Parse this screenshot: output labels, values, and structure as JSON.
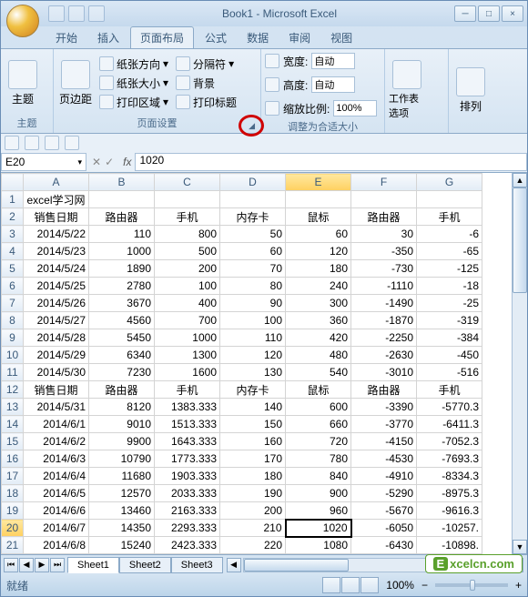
{
  "title": "Book1 - Microsoft Excel",
  "tabs": {
    "t0": "开始",
    "t1": "插入",
    "t2": "页面布局",
    "t3": "公式",
    "t4": "数据",
    "t5": "审阅",
    "t6": "视图"
  },
  "ribbon": {
    "theme_label": "主题",
    "theme_btn": "主题",
    "margins": "页边距",
    "page_setup_label": "页面设置",
    "orientation": "纸张方向",
    "size": "纸张大小",
    "print_area": "打印区域",
    "breaks": "分隔符",
    "background": "背景",
    "print_titles": "打印标题",
    "width_label": "宽度:",
    "height_label": "高度:",
    "scale_label": "缩放比例:",
    "auto": "自动",
    "scale_value": "100%",
    "scale_group": "调整为合适大小",
    "sheet_options": "工作表选项",
    "arrange": "排列"
  },
  "namebox": "E20",
  "formula": "1020",
  "columns": [
    "A",
    "B",
    "C",
    "D",
    "E",
    "F",
    "G"
  ],
  "rows": [
    {
      "n": "1",
      "cells": [
        "excel学习网",
        "",
        "",
        "",
        "",
        "",
        ""
      ],
      "text": true
    },
    {
      "n": "2",
      "cells": [
        "销售日期",
        "路由器",
        "手机",
        "内存卡",
        "鼠标",
        "路由器",
        "手机"
      ],
      "text": true
    },
    {
      "n": "3",
      "cells": [
        "2014/5/22",
        "110",
        "800",
        "50",
        "60",
        "30",
        "-6"
      ]
    },
    {
      "n": "4",
      "cells": [
        "2014/5/23",
        "1000",
        "500",
        "60",
        "120",
        "-350",
        "-65"
      ]
    },
    {
      "n": "5",
      "cells": [
        "2014/5/24",
        "1890",
        "200",
        "70",
        "180",
        "-730",
        "-125"
      ]
    },
    {
      "n": "6",
      "cells": [
        "2014/5/25",
        "2780",
        "100",
        "80",
        "240",
        "-1110",
        "-18"
      ]
    },
    {
      "n": "7",
      "cells": [
        "2014/5/26",
        "3670",
        "400",
        "90",
        "300",
        "-1490",
        "-25"
      ]
    },
    {
      "n": "8",
      "cells": [
        "2014/5/27",
        "4560",
        "700",
        "100",
        "360",
        "-1870",
        "-319"
      ]
    },
    {
      "n": "9",
      "cells": [
        "2014/5/28",
        "5450",
        "1000",
        "110",
        "420",
        "-2250",
        "-384"
      ]
    },
    {
      "n": "10",
      "cells": [
        "2014/5/29",
        "6340",
        "1300",
        "120",
        "480",
        "-2630",
        "-450"
      ]
    },
    {
      "n": "11",
      "cells": [
        "2014/5/30",
        "7230",
        "1600",
        "130",
        "540",
        "-3010",
        "-516"
      ]
    },
    {
      "n": "12",
      "cells": [
        "销售日期",
        "路由器",
        "手机",
        "内存卡",
        "鼠标",
        "路由器",
        "手机"
      ],
      "text": true
    },
    {
      "n": "13",
      "cells": [
        "2014/5/31",
        "8120",
        "1383.333",
        "140",
        "600",
        "-3390",
        "-5770.3"
      ]
    },
    {
      "n": "14",
      "cells": [
        "2014/6/1",
        "9010",
        "1513.333",
        "150",
        "660",
        "-3770",
        "-6411.3"
      ]
    },
    {
      "n": "15",
      "cells": [
        "2014/6/2",
        "9900",
        "1643.333",
        "160",
        "720",
        "-4150",
        "-7052.3"
      ]
    },
    {
      "n": "16",
      "cells": [
        "2014/6/3",
        "10790",
        "1773.333",
        "170",
        "780",
        "-4530",
        "-7693.3"
      ]
    },
    {
      "n": "17",
      "cells": [
        "2014/6/4",
        "11680",
        "1903.333",
        "180",
        "840",
        "-4910",
        "-8334.3"
      ]
    },
    {
      "n": "18",
      "cells": [
        "2014/6/5",
        "12570",
        "2033.333",
        "190",
        "900",
        "-5290",
        "-8975.3"
      ]
    },
    {
      "n": "19",
      "cells": [
        "2014/6/6",
        "13460",
        "2163.333",
        "200",
        "960",
        "-5670",
        "-9616.3"
      ]
    },
    {
      "n": "20",
      "cells": [
        "2014/6/7",
        "14350",
        "2293.333",
        "210",
        "1020",
        "-6050",
        "-10257."
      ]
    },
    {
      "n": "21",
      "cells": [
        "2014/6/8",
        "15240",
        "2423.333",
        "220",
        "1080",
        "-6430",
        "-10898."
      ]
    }
  ],
  "selected": {
    "row": "20",
    "col": 4
  },
  "sheets": {
    "s1": "Sheet1",
    "s2": "Sheet2",
    "s3": "Sheet3"
  },
  "status": "就绪",
  "zoom": "100%",
  "watermark": "xcelcn.com"
}
